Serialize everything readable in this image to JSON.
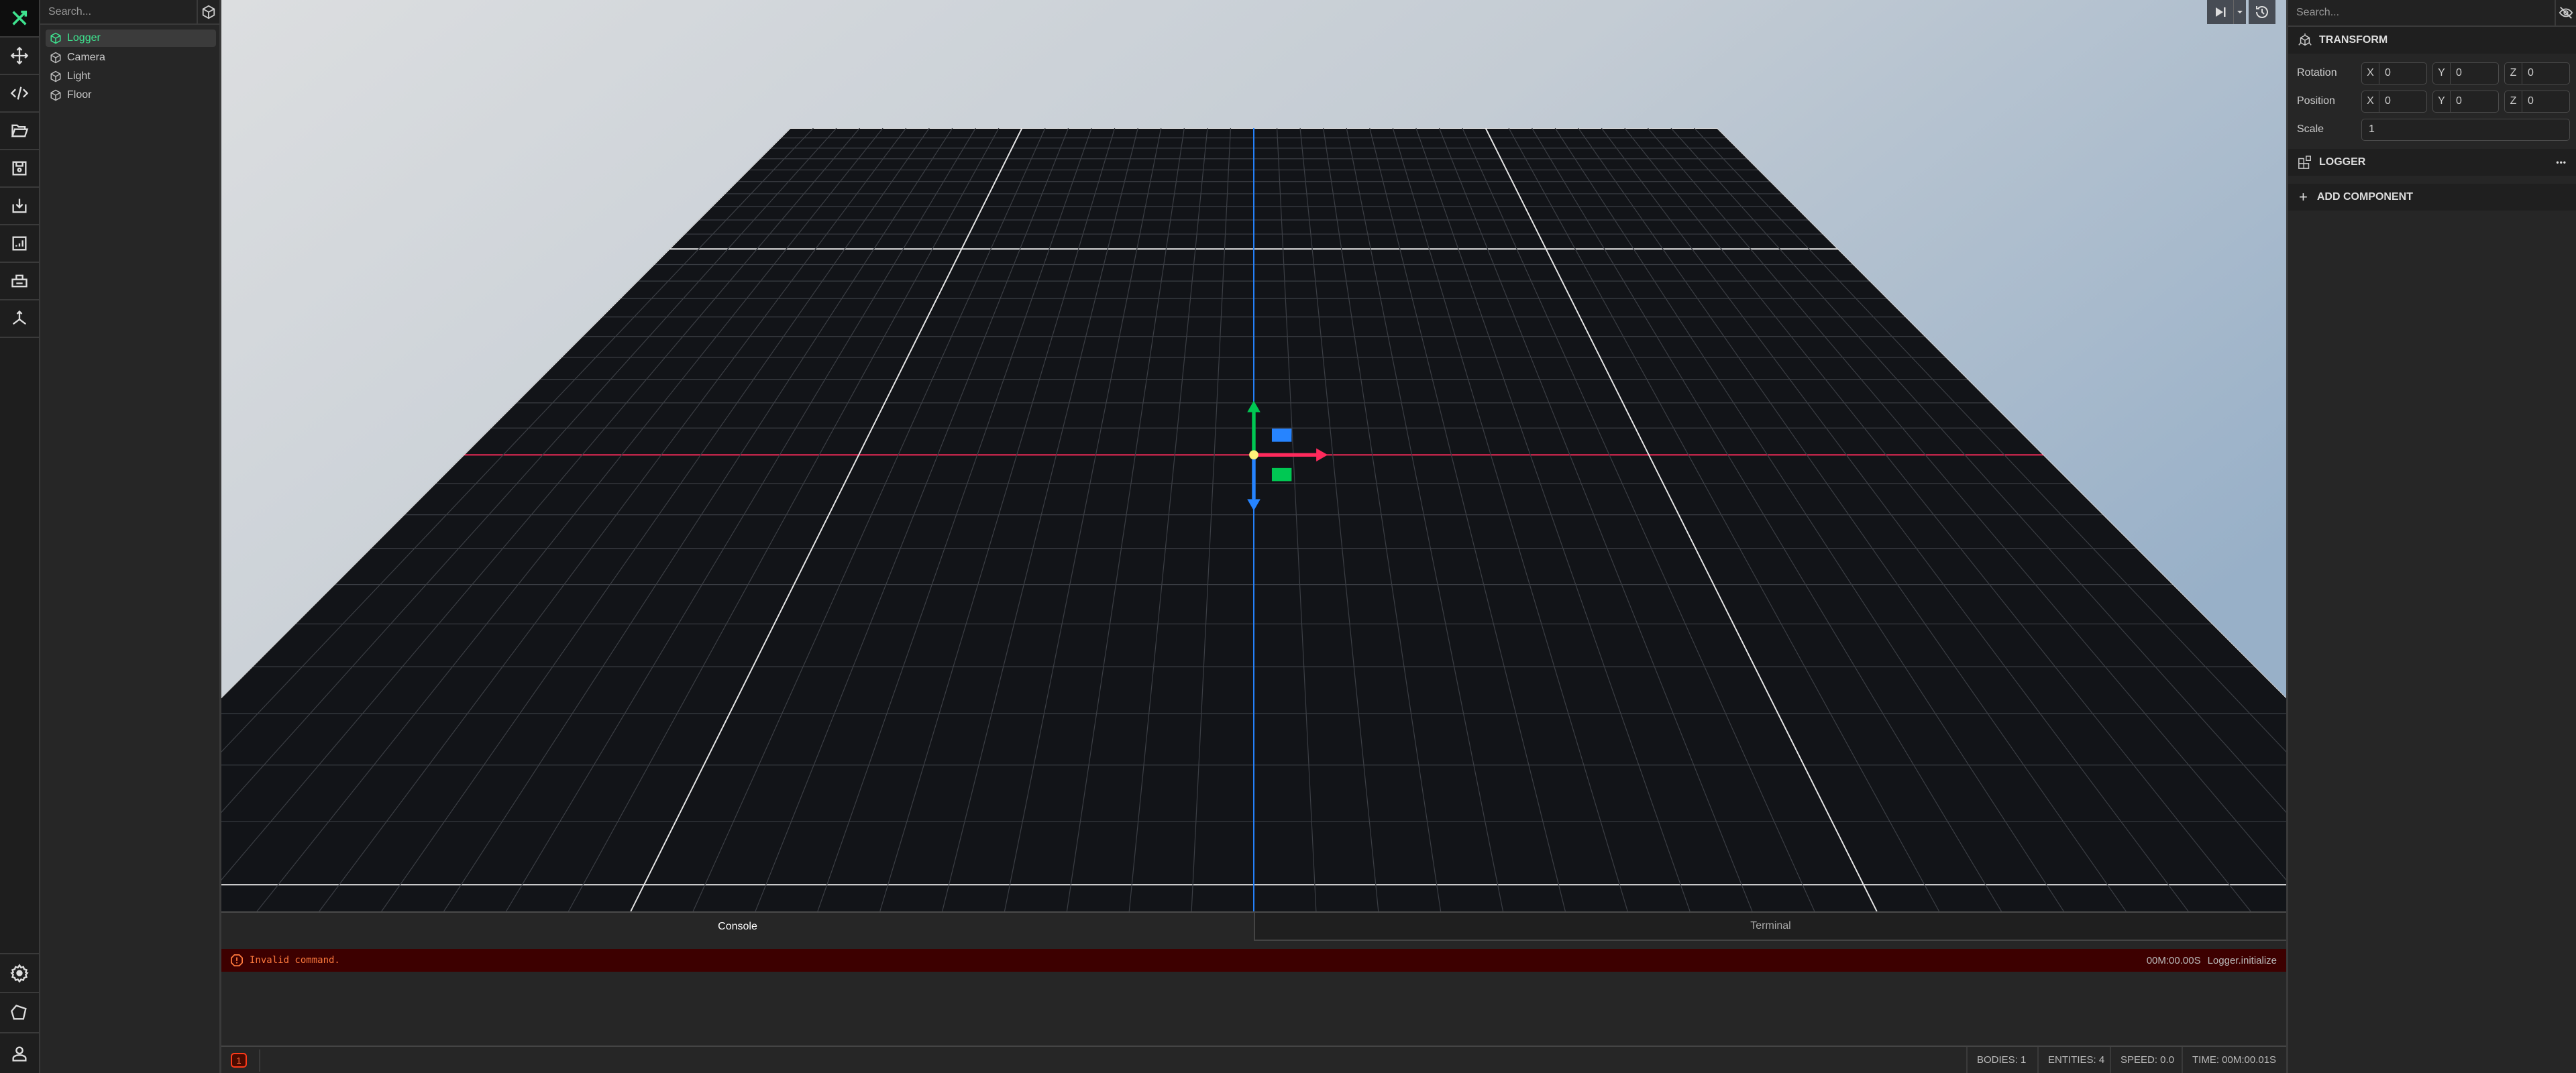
{
  "colors": {
    "accent": "#3ee38f",
    "error_bg": "#3d0000",
    "error_text": "#ff7a3d",
    "x_axis": "#ff2a5c",
    "y_axis": "#00c853",
    "z_axis": "#2684ff",
    "pivot": "#fff27a"
  },
  "iconbar": {
    "top": [
      "tools-icon",
      "move-icon",
      "code-icon",
      "folder-open-icon",
      "save-icon",
      "import-icon",
      "chart-icon",
      "vr-headset-icon",
      "axes-icon"
    ],
    "bottom": [
      "gear-icon",
      "shape-icon",
      "user-icon"
    ]
  },
  "tree": {
    "search_placeholder": "Search...",
    "items": [
      {
        "label": "Logger",
        "selected": true
      },
      {
        "label": "Camera"
      },
      {
        "label": "Light"
      },
      {
        "label": "Floor"
      }
    ]
  },
  "viewport": {
    "play_icon": "step-play-icon",
    "dropdown_icon": "caret-down-icon",
    "history_icon": "history-icon"
  },
  "console": {
    "tabs": [
      {
        "label": "Console",
        "active": true
      },
      {
        "label": "Terminal"
      }
    ],
    "entries": [
      {
        "level": "error",
        "message": "Invalid command.",
        "time": "00M:00.00S",
        "source": "Logger.initialize"
      }
    ],
    "error_count": "1"
  },
  "status": {
    "bodies": "BODIES: 1",
    "entities": "ENTITIES: 4",
    "speed": "SPEED: 0.0",
    "time": "TIME: 00M:00.01S"
  },
  "inspector": {
    "search_placeholder": "Search...",
    "transform_title": "TRANSFORM",
    "rotation": {
      "label": "Rotation",
      "x": "0",
      "y": "0",
      "z": "0"
    },
    "position": {
      "label": "Position",
      "x": "0",
      "y": "0",
      "z": "0"
    },
    "scale": {
      "label": "Scale",
      "value": "1"
    },
    "axis_labels": {
      "x": "X",
      "y": "Y",
      "z": "Z"
    },
    "logger_title": "LOGGER",
    "more_label": "•••",
    "add_component": "ADD COMPONENT",
    "add_icon": "+"
  }
}
